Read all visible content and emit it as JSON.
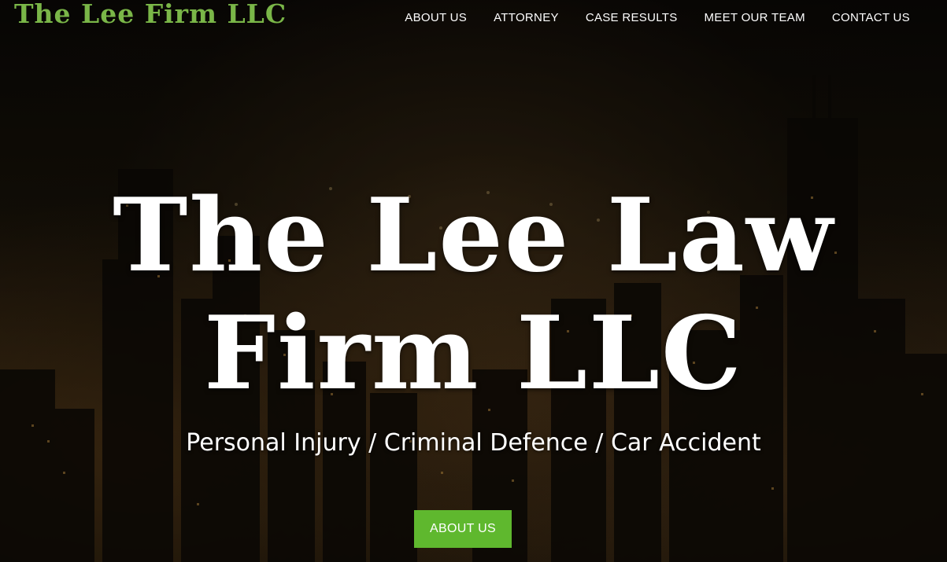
{
  "header": {
    "logo_text": "The Lee Firm LLC",
    "nav": [
      {
        "label": "ABOUT US"
      },
      {
        "label": "ATTORNEY"
      },
      {
        "label": "CASE RESULTS"
      },
      {
        "label": "MEET OUR TEAM"
      },
      {
        "label": "CONTACT US"
      }
    ]
  },
  "hero": {
    "title": "The Lee Law Firm LLC",
    "subtitle": "Personal Injury / Criminal Defence / Car Accident",
    "cta_label": "ABOUT US",
    "background": "night city skyline"
  },
  "colors": {
    "brand_green": "#7ab648",
    "button_green": "#5fb82e",
    "text_white": "#ffffff"
  }
}
